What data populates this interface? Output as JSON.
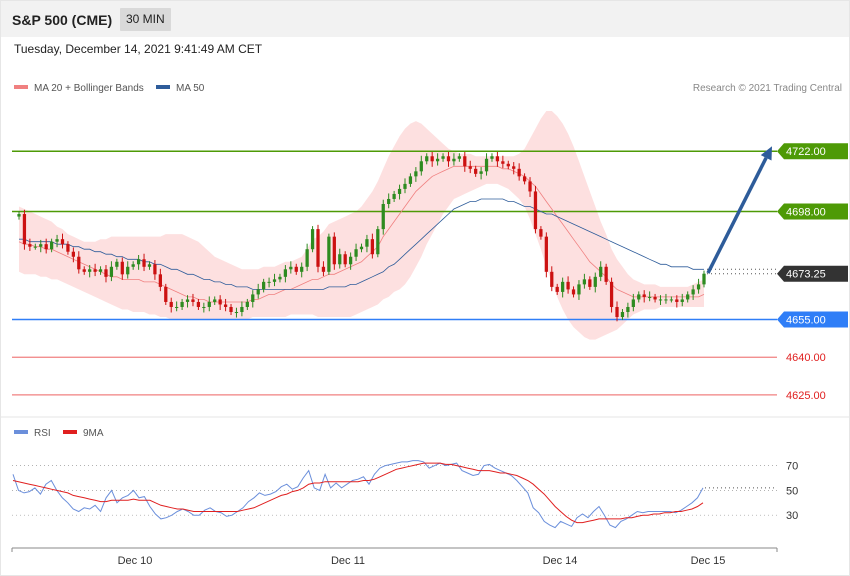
{
  "header": {
    "title": "S&P 500 (CME)",
    "timeframe": "30 MIN",
    "timestamp": "Tuesday, December 14, 2021 9:41:49 AM CET"
  },
  "colors": {
    "resistance": "#4e9a06",
    "support": "#2f7ef7",
    "target_red": "#f08080",
    "ma20_band": "#fde0e0",
    "ma20_line": "#f08080",
    "ma50_line": "#2e5c9a",
    "candle_up": "#2e8b20",
    "candle_down": "#cc1111",
    "arrow": "#2e5c9a",
    "rsi_line": "#6b8fdb",
    "rsi_ma": "#e02020"
  },
  "chart_data": [
    {
      "type": "candlestick",
      "legend": [
        {
          "label": "MA 20 + Bollinger Bands",
          "color": "#f08080"
        },
        {
          "label": "MA 50",
          "color": "#2e5c9a"
        }
      ],
      "credit": "Research © 2021 Trading Central",
      "x_ticks": [
        "Dec 10",
        "Dec 11",
        "Dec 14",
        "Dec 15"
      ],
      "ylim": [
        4617,
        4742
      ],
      "levels": [
        {
          "value": 4722.0,
          "label": "4722.00",
          "kind": "resistance"
        },
        {
          "value": 4698.0,
          "label": "4698.00",
          "kind": "resistance"
        },
        {
          "value": 4655.0,
          "label": "4655.00",
          "kind": "support"
        },
        {
          "value": 4640.0,
          "label": "4640.00",
          "kind": "target"
        },
        {
          "value": 4625.0,
          "label": "4625.00",
          "kind": "target"
        }
      ],
      "current_price": {
        "value": 4673.25,
        "label": "4673.25"
      },
      "projection": {
        "from": 4673.5,
        "to": 4724
      },
      "closes": [
        4697,
        4685,
        4684,
        4684,
        4685,
        4683,
        4686,
        4687,
        4685,
        4682,
        4680,
        4675,
        4674,
        4675,
        4674,
        4675,
        4672,
        4676,
        4678,
        4673,
        4676,
        4677,
        4679,
        4676,
        4677,
        4673,
        4668,
        4662,
        4660,
        4660,
        4662,
        4663,
        4662,
        4660,
        4660,
        4662,
        4663,
        4661,
        4660,
        4658,
        4658,
        4660,
        4662,
        4665,
        4667,
        4670,
        4670,
        4671,
        4672,
        4675,
        4676,
        4674,
        4676,
        4683,
        4691,
        4676,
        4674,
        4688,
        4677,
        4681,
        4677,
        4680,
        4683,
        4684,
        4687,
        4681,
        4691,
        4701,
        4703,
        4705,
        4707,
        4709,
        4712,
        4714,
        4718,
        4720,
        4718,
        4719,
        4720,
        4718,
        4719,
        4720,
        4716,
        4715,
        4713,
        4714,
        4719,
        4720,
        4718,
        4717,
        4716,
        4715,
        4712,
        4710,
        4706,
        4691,
        4688,
        4674,
        4668,
        4666,
        4670,
        4667,
        4665,
        4669,
        4671,
        4668,
        4672,
        4676,
        4670,
        4660,
        4656,
        4658,
        4660,
        4663,
        4665,
        4664,
        4664,
        4663,
        4663,
        4663,
        4663,
        4662,
        4663,
        4665,
        4667,
        4669,
        4673.25
      ],
      "ma20": [
        4686,
        4685,
        4685,
        4684,
        4684,
        4683,
        4683,
        4682,
        4681,
        4680,
        4679,
        4678,
        4677,
        4676,
        4675,
        4674,
        4673,
        4672,
        4672,
        4671,
        4671,
        4671,
        4671,
        4670,
        4670,
        4670,
        4669,
        4668,
        4667,
        4666,
        4665,
        4664,
        4664,
        4663,
        4663,
        4662,
        4662,
        4662,
        4662,
        4662,
        4662,
        4662,
        4662,
        4663,
        4663,
        4664,
        4665,
        4665,
        4666,
        4667,
        4667,
        4668,
        4669,
        4670,
        4671,
        4671,
        4672,
        4673,
        4673,
        4674,
        4675,
        4676,
        4677,
        4678,
        4680,
        4682,
        4684,
        4688,
        4691,
        4694,
        4697,
        4700,
        4703,
        4706,
        4708,
        4710,
        4712,
        4713,
        4714,
        4715,
        4716,
        4716,
        4716,
        4716,
        4716,
        4716,
        4716,
        4716,
        4716,
        4715,
        4715,
        4714,
        4713,
        4712,
        4710,
        4708,
        4705,
        4702,
        4699,
        4696,
        4693,
        4690,
        4687,
        4684,
        4681,
        4678,
        4676,
        4674,
        4672,
        4669,
        4667,
        4666,
        4665,
        4664,
        4664,
        4664,
        4664,
        4664,
        4664,
        4664,
        4664,
        4664,
        4664,
        4664,
        4664,
        4664,
        4665
      ],
      "bb_upper": [
        4700,
        4699,
        4698,
        4697,
        4696,
        4695,
        4694,
        4692,
        4691,
        4689,
        4688,
        4687,
        4686,
        4686,
        4686,
        4687,
        4687,
        4688,
        4688,
        4688,
        4688,
        4688,
        4688,
        4688,
        4688,
        4688,
        4688,
        4689,
        4689,
        4689,
        4689,
        4688,
        4687,
        4686,
        4684,
        4682,
        4680,
        4679,
        4678,
        4677,
        4676,
        4675,
        4675,
        4675,
        4675,
        4676,
        4676,
        4676,
        4677,
        4678,
        4678,
        4679,
        4680,
        4683,
        4687,
        4688,
        4690,
        4693,
        4694,
        4695,
        4696,
        4697,
        4698,
        4700,
        4703,
        4706,
        4710,
        4715,
        4720,
        4724,
        4728,
        4731,
        4733,
        4734,
        4733,
        4731,
        4729,
        4727,
        4725,
        4723,
        4722,
        4721,
        4721,
        4721,
        4720,
        4720,
        4720,
        4720,
        4720,
        4720,
        4720,
        4720,
        4721,
        4723,
        4727,
        4731,
        4735,
        4738,
        4738,
        4736,
        4733,
        4729,
        4724,
        4718,
        4712,
        4706,
        4700,
        4694,
        4689,
        4683,
        4679,
        4676,
        4673,
        4671,
        4670,
        4669,
        4669,
        4669,
        4668,
        4668,
        4668,
        4668,
        4668,
        4668,
        4669,
        4670,
        4671
      ],
      "bb_lower": [
        4674,
        4673,
        4673,
        4673,
        4672,
        4672,
        4671,
        4671,
        4670,
        4669,
        4668,
        4667,
        4666,
        4665,
        4664,
        4663,
        4662,
        4661,
        4660,
        4659,
        4659,
        4658,
        4658,
        4658,
        4657,
        4657,
        4656,
        4656,
        4655,
        4655,
        4655,
        4655,
        4655,
        4655,
        4655,
        4655,
        4655,
        4655,
        4655,
        4655,
        4655,
        4655,
        4655,
        4656,
        4656,
        4656,
        4656,
        4656,
        4656,
        4656,
        4657,
        4657,
        4657,
        4657,
        4657,
        4656,
        4656,
        4656,
        4656,
        4656,
        4656,
        4656,
        4657,
        4658,
        4659,
        4660,
        4661,
        4663,
        4664,
        4666,
        4667,
        4669,
        4672,
        4676,
        4680,
        4685,
        4689,
        4693,
        4697,
        4700,
        4703,
        4704,
        4705,
        4706,
        4707,
        4708,
        4709,
        4709,
        4709,
        4708,
        4707,
        4705,
        4703,
        4700,
        4695,
        4689,
        4683,
        4676,
        4670,
        4664,
        4659,
        4655,
        4652,
        4650,
        4648,
        4647,
        4647,
        4648,
        4649,
        4650,
        4651,
        4653,
        4655,
        4657,
        4658,
        4659,
        4659,
        4659,
        4660,
        4660,
        4660,
        4660,
        4660,
        4660,
        4660,
        4660,
        4660
      ],
      "ma50": [
        4687,
        4687,
        4686,
        4686,
        4686,
        4686,
        4686,
        4685,
        4685,
        4685,
        4684,
        4684,
        4683,
        4683,
        4682,
        4682,
        4681,
        4681,
        4680,
        4680,
        4679,
        4679,
        4679,
        4678,
        4678,
        4677,
        4677,
        4676,
        4675,
        4675,
        4674,
        4673,
        4673,
        4672,
        4671,
        4671,
        4670,
        4670,
        4669,
        4669,
        4668,
        4668,
        4668,
        4667,
        4667,
        4667,
        4667,
        4667,
        4667,
        4667,
        4667,
        4667,
        4667,
        4667,
        4667,
        4667,
        4667,
        4668,
        4668,
        4668,
        4668,
        4669,
        4669,
        4670,
        4671,
        4672,
        4673,
        4674,
        4676,
        4677,
        4679,
        4681,
        4683,
        4685,
        4687,
        4689,
        4691,
        4693,
        4695,
        4697,
        4699,
        4700,
        4701,
        4702,
        4702,
        4703,
        4703,
        4703,
        4703,
        4703,
        4702,
        4702,
        4701,
        4700,
        4700,
        4699,
        4698,
        4697,
        4697,
        4696,
        4695,
        4694,
        4693,
        4692,
        4691,
        4690,
        4689,
        4688,
        4687,
        4686,
        4685,
        4684,
        4683,
        4682,
        4681,
        4680,
        4679,
        4678,
        4677,
        4677,
        4676,
        4676,
        4676,
        4676,
        4675,
        4675,
        4675
      ]
    },
    {
      "type": "line",
      "legend": [
        {
          "label": "RSI",
          "color": "#6b8fdb"
        },
        {
          "label": "9MA",
          "color": "#e02020"
        }
      ],
      "y_ticks": [
        "70",
        "50",
        "30"
      ],
      "ylim": [
        10,
        85
      ],
      "rsi": [
        63,
        50,
        48,
        49,
        52,
        47,
        55,
        58,
        50,
        44,
        40,
        35,
        33,
        36,
        35,
        38,
        33,
        44,
        50,
        40,
        44,
        46,
        50,
        44,
        45,
        37,
        31,
        27,
        28,
        30,
        33,
        35,
        33,
        30,
        30,
        34,
        36,
        33,
        32,
        29,
        30,
        33,
        36,
        41,
        44,
        48,
        46,
        47,
        49,
        53,
        55,
        51,
        53,
        60,
        66,
        52,
        50,
        63,
        52,
        56,
        52,
        55,
        58,
        59,
        61,
        55,
        63,
        68,
        70,
        71,
        72,
        73,
        73,
        74,
        74,
        73,
        68,
        70,
        72,
        70,
        71,
        72,
        66,
        64,
        62,
        63,
        70,
        71,
        68,
        66,
        64,
        62,
        58,
        53,
        48,
        36,
        32,
        25,
        22,
        20,
        25,
        23,
        21,
        28,
        31,
        28,
        33,
        37,
        30,
        22,
        20,
        25,
        27,
        30,
        33,
        32,
        33,
        33,
        33,
        33,
        33,
        32,
        34,
        37,
        40,
        44,
        52
      ],
      "ma9": [
        58,
        57,
        56,
        55,
        54,
        53,
        52,
        51,
        50,
        49,
        48,
        46,
        45,
        44,
        43,
        42,
        41,
        41,
        42,
        42,
        42,
        42,
        43,
        42,
        42,
        42,
        40,
        38,
        37,
        36,
        35,
        35,
        34,
        33,
        33,
        33,
        33,
        33,
        33,
        33,
        33,
        33,
        34,
        35,
        36,
        38,
        40,
        42,
        44,
        46,
        47,
        49,
        50,
        52,
        55,
        56,
        56,
        57,
        57,
        57,
        57,
        57,
        57,
        57,
        58,
        58,
        59,
        61,
        63,
        65,
        67,
        68,
        69,
        70,
        71,
        72,
        72,
        72,
        72,
        71,
        71,
        70,
        69,
        68,
        67,
        66,
        66,
        66,
        65,
        64,
        64,
        63,
        62,
        60,
        58,
        55,
        51,
        47,
        42,
        37,
        33,
        29,
        26,
        24,
        24,
        25,
        26,
        27,
        27,
        27,
        27,
        27,
        28,
        28,
        29,
        30,
        30,
        31,
        31,
        32,
        32,
        33,
        33,
        34,
        35,
        37,
        40
      ]
    }
  ]
}
